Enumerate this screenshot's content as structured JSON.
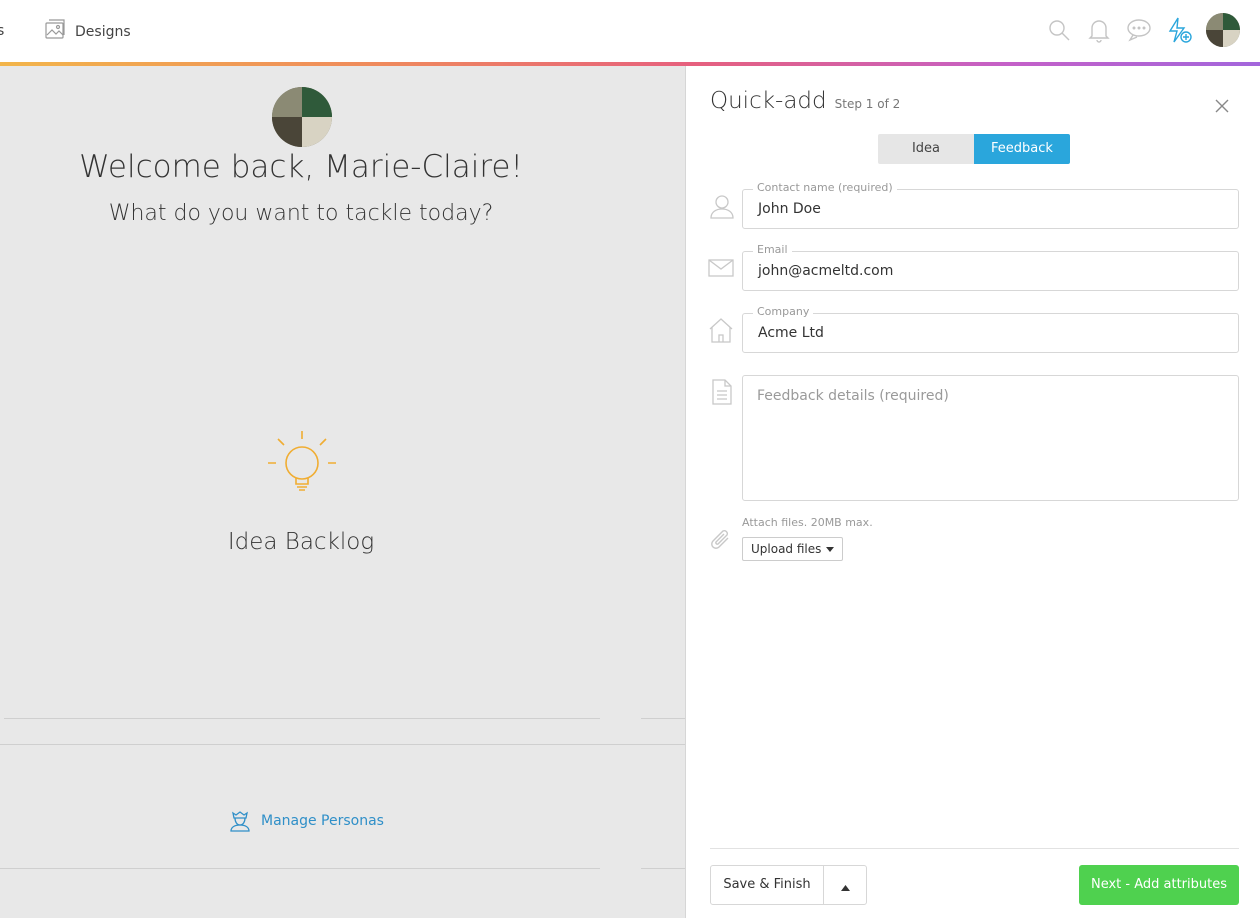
{
  "nav": {
    "cut_label": "s",
    "designs_label": "Designs"
  },
  "welcome": {
    "heading": "Welcome back, Marie-Claire!",
    "subheading": "What do you want to tackle today?"
  },
  "backlog": {
    "label": "Idea Backlog"
  },
  "personas": {
    "label": "Manage Personas"
  },
  "panel": {
    "title": "Quick-add",
    "step": "Step 1 of 2",
    "tabs": [
      {
        "label": "Idea",
        "active": false
      },
      {
        "label": "Feedback",
        "active": true
      }
    ],
    "fields": {
      "contact": {
        "label": "Contact name (required)",
        "value": "John Doe"
      },
      "email": {
        "label": "Email",
        "value": "john@acmeltd.com"
      },
      "company": {
        "label": "Company",
        "value": "Acme Ltd"
      },
      "details": {
        "placeholder": "Feedback details (required)"
      }
    },
    "attach": {
      "hint": "Attach files. 20MB max.",
      "upload_label": "Upload files"
    },
    "footer": {
      "save_label": "Save & Finish",
      "next_label": "Next - Add attributes"
    }
  },
  "colors": {
    "accent_blue": "#2aa6dc",
    "next_green": "#4fd14f",
    "bulb": "#f0ad32",
    "link_blue": "#2f8fc8"
  }
}
